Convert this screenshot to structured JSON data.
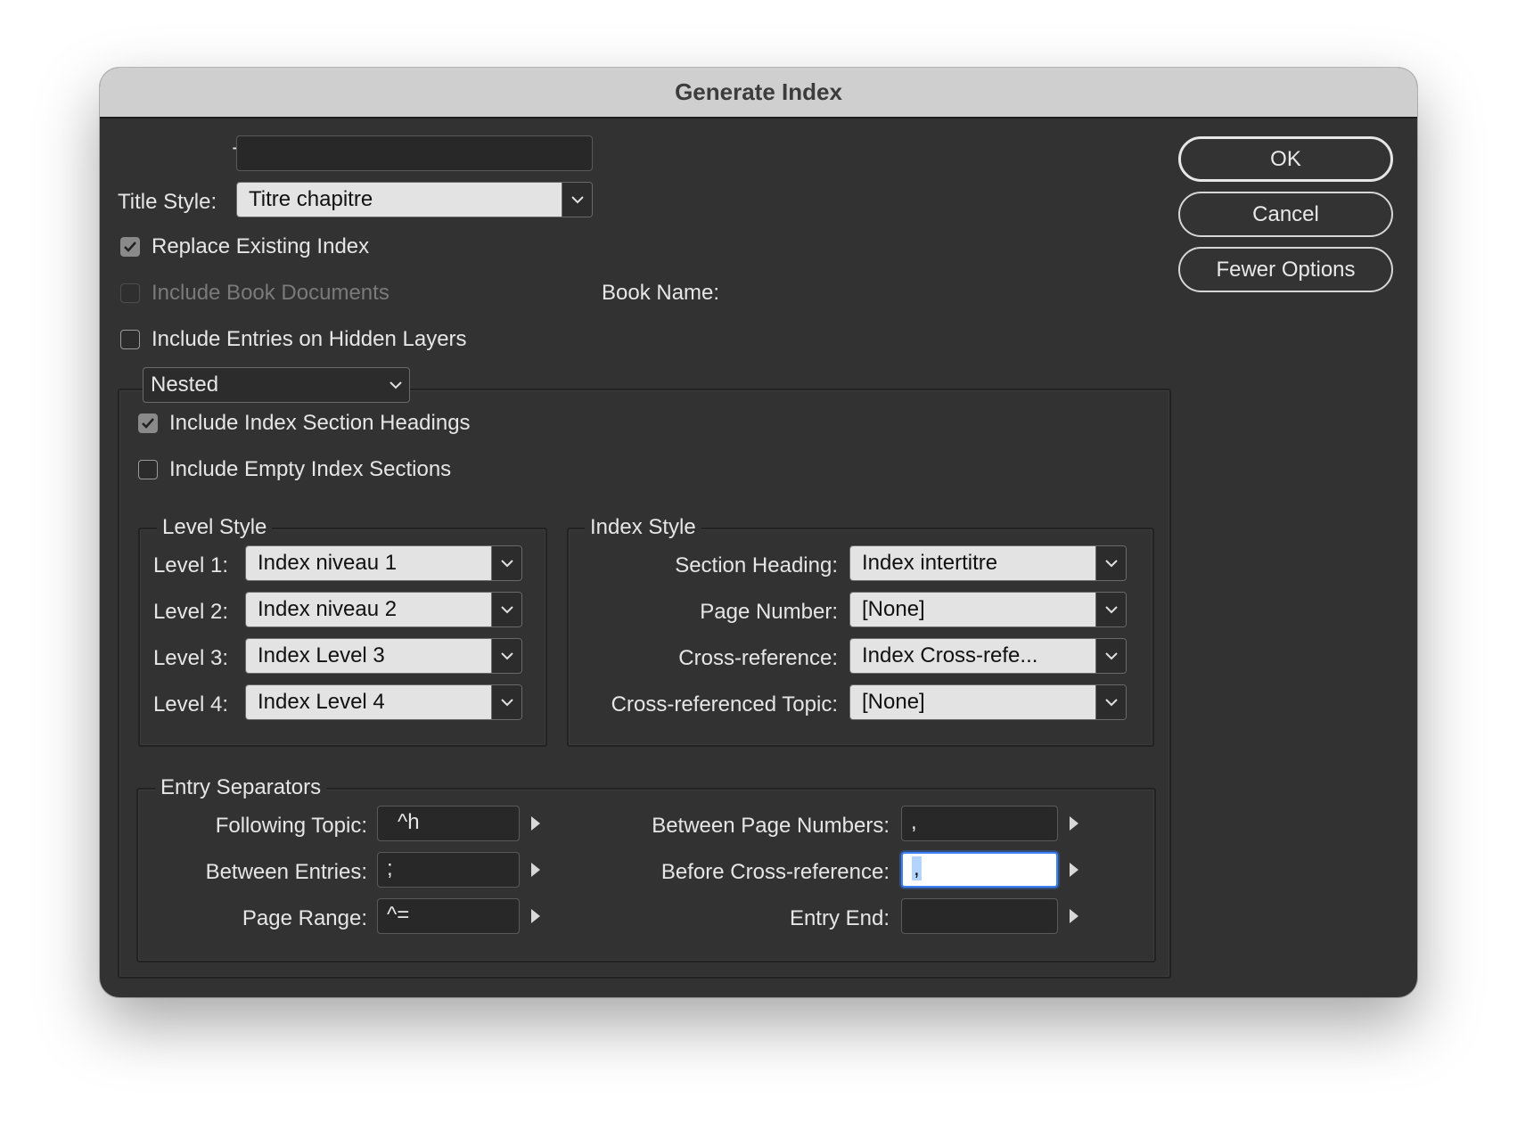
{
  "dialog": {
    "title": "Generate Index"
  },
  "top": {
    "title_label": "Title:",
    "title_value": "",
    "title_style_label": "Title Style:",
    "title_style_value": "Titre chapitre",
    "replace_existing": {
      "label": "Replace Existing Index",
      "checked": true
    },
    "include_book": {
      "label": "Include Book Documents",
      "checked": false,
      "disabled": true
    },
    "book_name_label": "Book Name:",
    "include_hidden": {
      "label": "Include Entries on Hidden Layers",
      "checked": false
    }
  },
  "buttons": {
    "ok": "OK",
    "cancel": "Cancel",
    "fewer": "Fewer Options"
  },
  "options": {
    "format_value": "Nested",
    "section_headings": {
      "label": "Include Index Section Headings",
      "checked": true
    },
    "empty_sections": {
      "label": "Include Empty Index Sections",
      "checked": false
    }
  },
  "level_style": {
    "legend": "Level Style",
    "levels": [
      {
        "label": "Level 1:",
        "value": "Index niveau 1"
      },
      {
        "label": "Level 2:",
        "value": "Index niveau 2"
      },
      {
        "label": "Level 3:",
        "value": "Index Level 3"
      },
      {
        "label": "Level 4:",
        "value": "Index Level 4"
      }
    ]
  },
  "index_style": {
    "legend": "Index Style",
    "rows": [
      {
        "label": "Section Heading:",
        "value": "Index intertitre"
      },
      {
        "label": "Page Number:",
        "value": "[None]"
      },
      {
        "label": "Cross-reference:",
        "value": "Index Cross-refe..."
      },
      {
        "label": "Cross-referenced Topic:",
        "value": "[None]"
      }
    ]
  },
  "separators": {
    "legend": "Entry Separators",
    "following_topic": {
      "label": "Following Topic:",
      "value": "^h"
    },
    "between_entries": {
      "label": "Between Entries:",
      "value": ";"
    },
    "page_range": {
      "label": "Page Range:",
      "value": "^="
    },
    "between_page_numbers": {
      "label": "Between Page Numbers:",
      "value": ","
    },
    "before_cross_reference": {
      "label": "Before Cross-reference:",
      "value": ","
    },
    "entry_end": {
      "label": "Entry End:",
      "value": ""
    }
  },
  "colors": {
    "dialog_bg": "#323232",
    "titlebar_bg": "#cfcfcf",
    "focus_ring": "#3b82f6"
  }
}
